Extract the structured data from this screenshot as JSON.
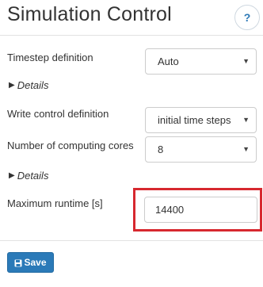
{
  "header": {
    "title": "Simulation Control",
    "help_label": "?"
  },
  "form": {
    "timestep": {
      "label": "Timestep definition",
      "selected": "Auto"
    },
    "details_1": "Details",
    "write_control": {
      "label": "Write control definition",
      "selected": "initial time steps"
    },
    "computing_cores": {
      "label": "Number of computing cores",
      "selected": "8"
    },
    "details_2": "Details",
    "max_runtime": {
      "label": "Maximum runtime [s]",
      "value": "14400"
    }
  },
  "actions": {
    "save_label": "Save"
  },
  "colors": {
    "primary": "#2b7ab8",
    "highlight": "#d7282f",
    "help_icon": "#2b78b6"
  }
}
